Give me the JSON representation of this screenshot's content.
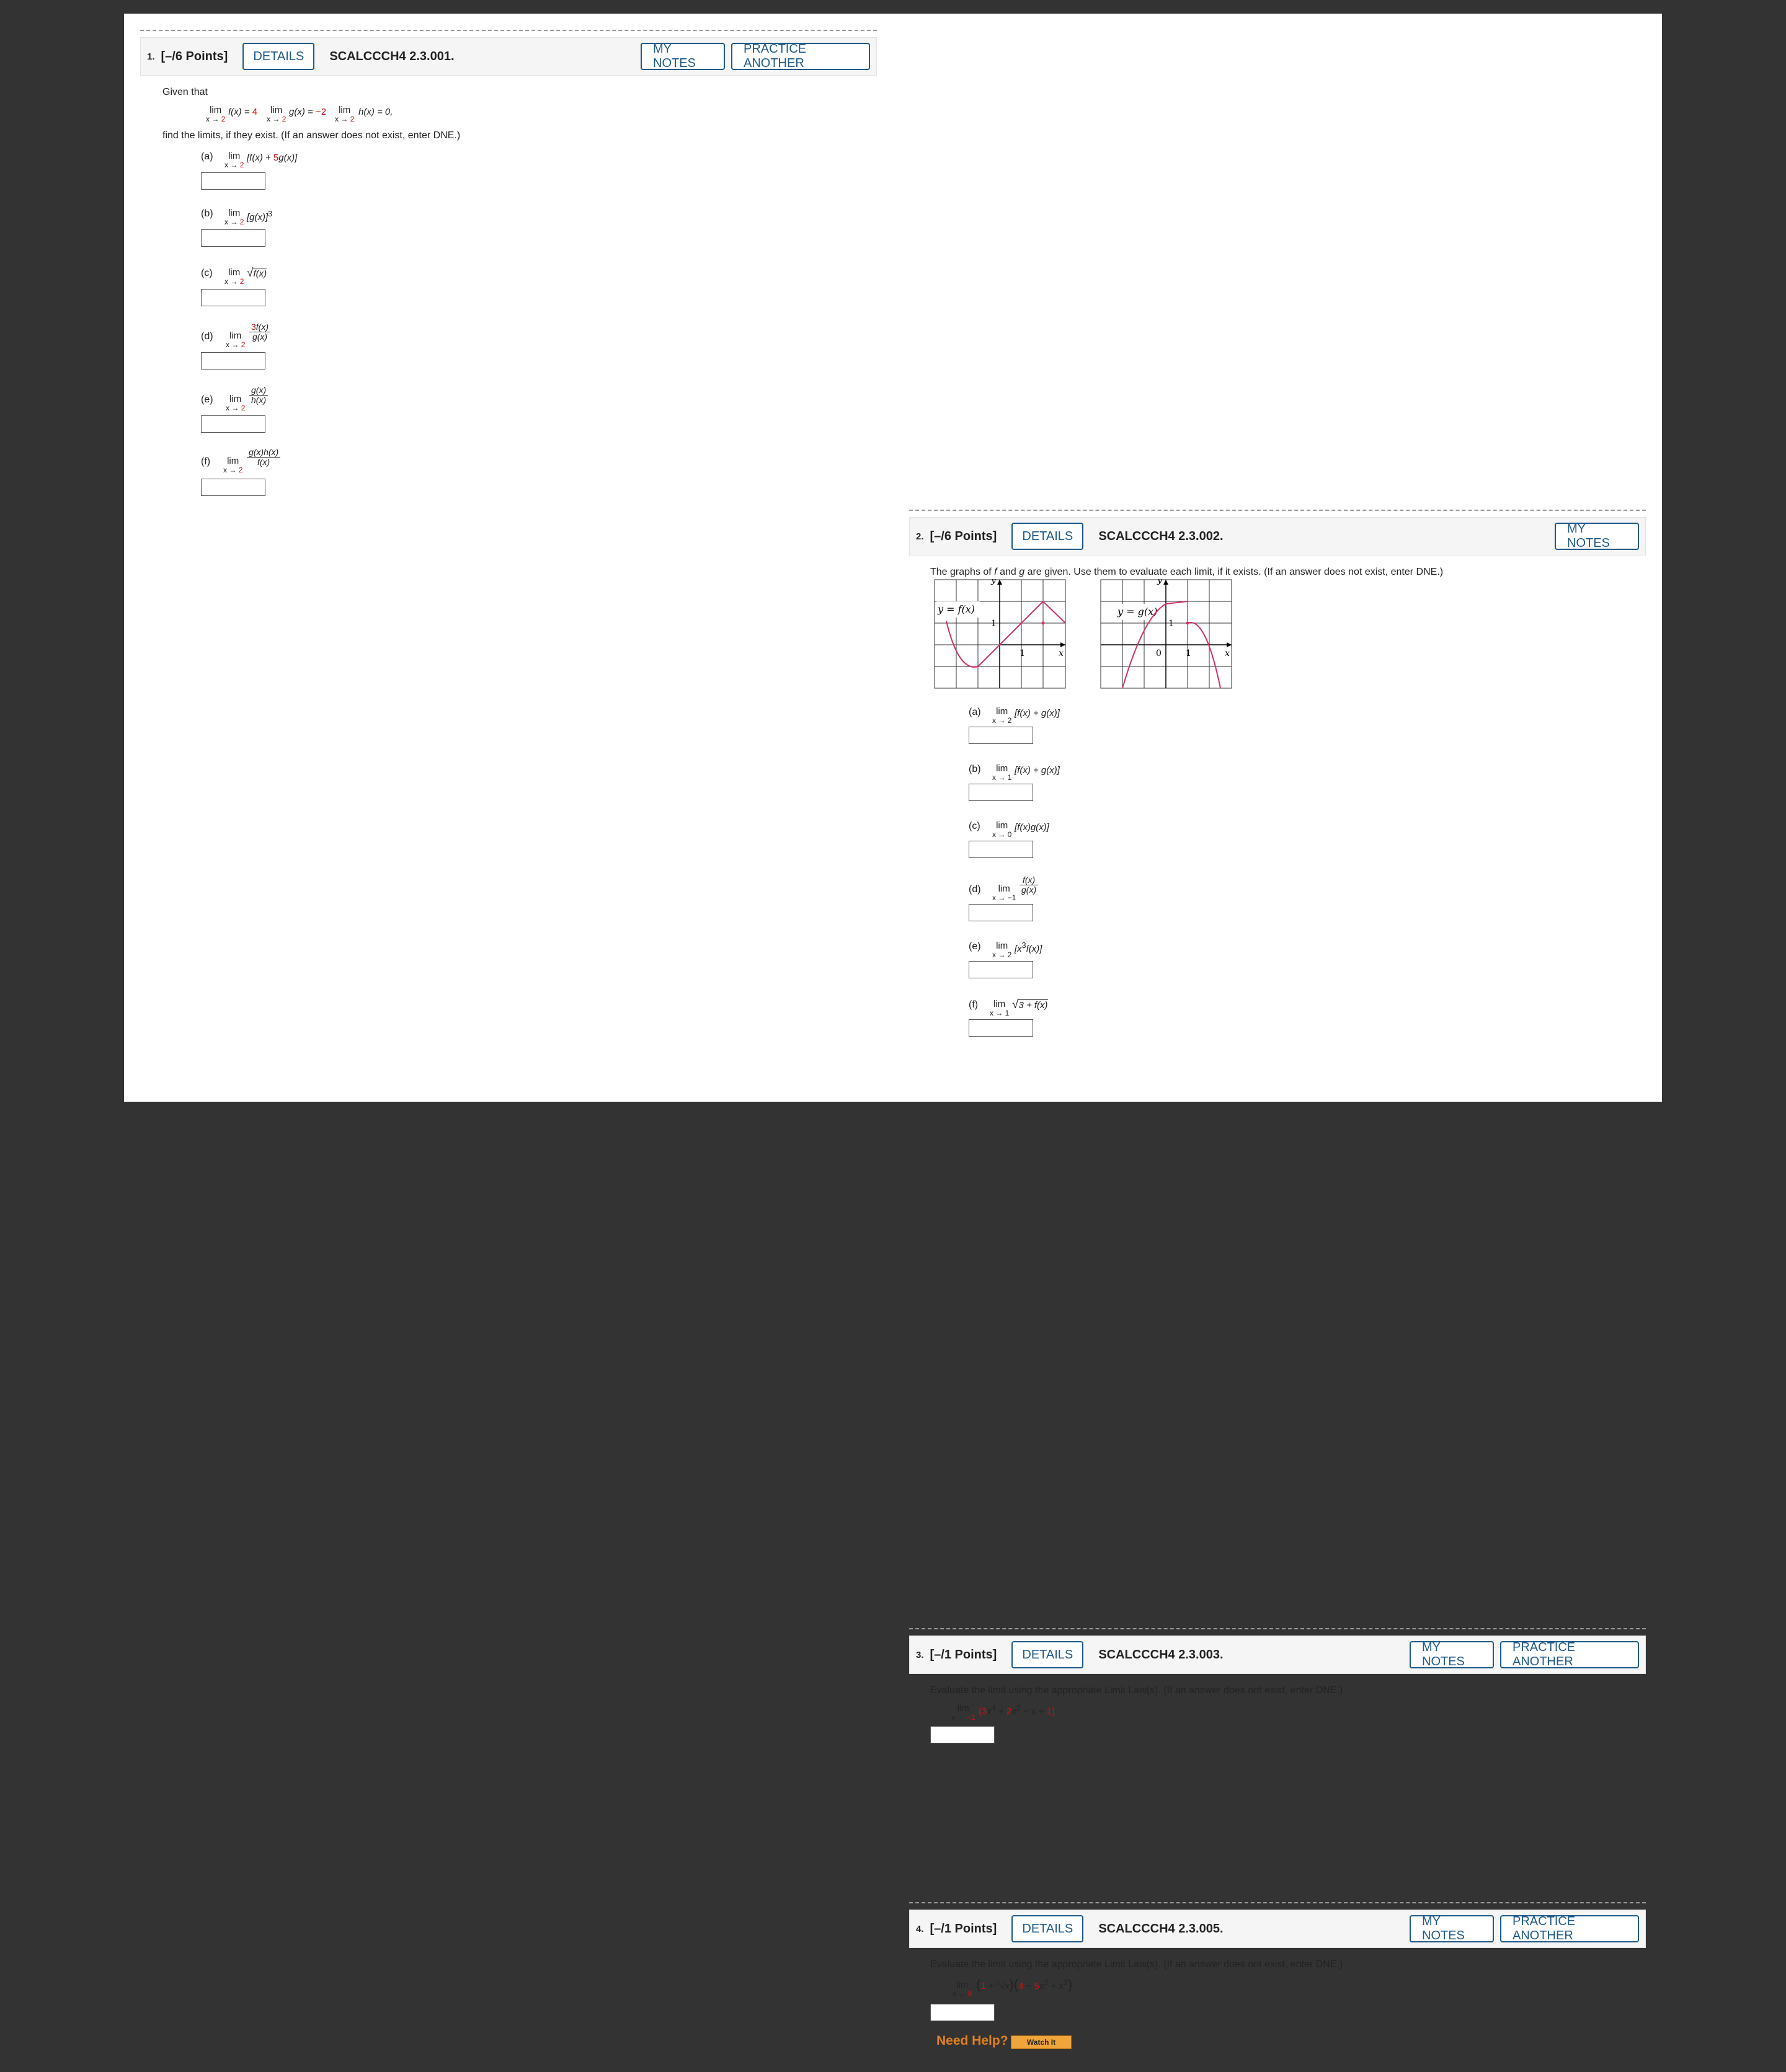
{
  "q1": {
    "num": "1.",
    "points": "[–/6 Points]",
    "details": "DETAILS",
    "code": "SCALCCCH4 2.3.001.",
    "notes": "MY NOTES",
    "practice": "PRACTICE ANOTHER",
    "given": "Given that",
    "given_limits": [
      {
        "lim": "lim",
        "sub_x": "x →",
        "sub_v": "2",
        "expr": "f(x) = ",
        "val": "4"
      },
      {
        "lim": "lim",
        "sub_x": "x →",
        "sub_v": "2",
        "expr": "g(x) = ",
        "val": "−2"
      },
      {
        "lim": "lim",
        "sub_x": "x →",
        "sub_v": "2",
        "expr": "h(x) = 0,",
        "val": ""
      }
    ],
    "instruction": "find the limits, if they exist. (If an answer does not exist, enter DNE.)",
    "parts": [
      {
        "label": "(a)",
        "lim": "lim",
        "sub_x": "x →",
        "sub_v": "2",
        "expr_a": "[f(x) + ",
        "expr_red": "5",
        "expr_b": "g(x)]"
      },
      {
        "label": "(b)",
        "lim": "lim",
        "sub_x": "x →",
        "sub_v": "2",
        "expr": "[g(x)]",
        "sup": "3"
      },
      {
        "label": "(c)",
        "lim": "lim",
        "sub_x": "x →",
        "sub_v": "2",
        "radical": "√",
        "expr": "f(x)"
      },
      {
        "label": "(d)",
        "lim": "lim",
        "sub_x": "x →",
        "sub_v": "2",
        "num_red": "3",
        "num": "f(x)",
        "den": "g(x)"
      },
      {
        "label": "(e)",
        "lim": "lim",
        "sub_x": "x →",
        "sub_v": "2",
        "num": "g(x)",
        "den": "h(x)"
      },
      {
        "label": "(f)",
        "lim": "lim",
        "sub_x": "x →",
        "sub_v": "2",
        "num": "g(x)h(x)",
        "den": "f(x)"
      }
    ]
  },
  "q2": {
    "num": "2.",
    "points": "[–/6 Points]",
    "details": "DETAILS",
    "code": "SCALCCCH4 2.3.002.",
    "notes": "MY NOTES",
    "intro_a": "The graphs of ",
    "intro_f": "f",
    "intro_b": " and ",
    "intro_g": "g",
    "intro_c": " are given. Use them to evaluate each limit, if it exists. (If an answer does not exist, enter DNE.)",
    "graph_f": {
      "label": "y = f(x)",
      "y": "y",
      "x": "x",
      "one_y": "1",
      "one_x": "1"
    },
    "graph_g": {
      "label": "y = g(x)",
      "y": "y",
      "x": "x",
      "one_y": "1",
      "one_x": "1",
      "zero": "0"
    },
    "parts": [
      {
        "label": "(a)",
        "lim": "lim",
        "sub": "x → 2",
        "expr": "[f(x) + g(x)]"
      },
      {
        "label": "(b)",
        "lim": "lim",
        "sub": "x → 1",
        "expr": "[f(x) + g(x)]"
      },
      {
        "label": "(c)",
        "lim": "lim",
        "sub": "x → 0",
        "expr": "[f(x)g(x)]"
      },
      {
        "label": "(d)",
        "lim": "lim",
        "sub": "x → −1",
        "num": "f(x)",
        "den": "g(x)"
      },
      {
        "label": "(e)",
        "lim": "lim",
        "sub": "x → 2",
        "expr_a": "[x",
        "sup": "3",
        "expr_b": "f(x)]"
      },
      {
        "label": "(f)",
        "lim": "lim",
        "sub": "x → 1",
        "radical": "√",
        "expr": "3 + f(x)"
      }
    ]
  },
  "q3": {
    "num": "3.",
    "points": "[–/1 Points]",
    "details": "DETAILS",
    "code": "SCALCCCH4 2.3.003.",
    "notes": "MY NOTES",
    "practice": "PRACTICE ANOTHER",
    "instruction": "Evaluate the limit using the appropriate Limit Law(s). (If an answer does not exist, enter DNE.)",
    "lim": "lim",
    "sub_x": "x →",
    "sub_v": "−1",
    "expr": {
      "p1": "(",
      "c1": "3",
      "t1": "x",
      "e1": "4",
      "p2": " + ",
      "c2": "2",
      "t2": "x",
      "e2": "2",
      "p3": " − x + ",
      "c3": "1",
      "p4": ")"
    }
  },
  "q4": {
    "num": "4.",
    "points": "[–/1 Points]",
    "details": "DETAILS",
    "code": "SCALCCCH4 2.3.005.",
    "notes": "MY NOTES",
    "practice": "PRACTICE ANOTHER",
    "instruction": "Evaluate the limit using the appropriate Limit Law(s). (If an answer does not exist, enter DNE.)",
    "lim": "lim",
    "sub_x": "x →",
    "sub_v": "8",
    "expr": {
      "o1": "(",
      "c1": "1",
      "plus1": " + ",
      "root_idx": "3",
      "root": "√",
      "rx": "x",
      "c1b": ")(",
      "c2": "4",
      "minus": " − ",
      "c3": "5",
      "t2": "x",
      "e2": "2",
      "plus2": " + x",
      "e3": "3",
      "c4": ")"
    },
    "need_help": "Need Help?",
    "watch": "Watch It"
  },
  "colors": {
    "accent": "#1f5a8b",
    "red": "#d01010",
    "curve": "#d0306a",
    "help": "#e0821f"
  }
}
